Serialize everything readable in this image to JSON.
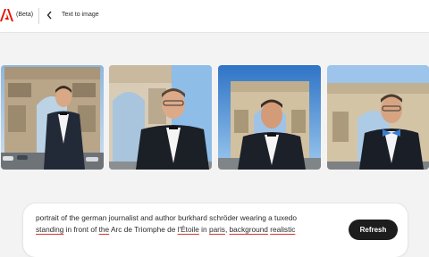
{
  "header": {
    "badge": "(Beta)",
    "title": "Text to image",
    "brand_color": "#eb1000"
  },
  "gallery": {
    "images": [
      {
        "label": "generated-image-1"
      },
      {
        "label": "generated-image-2"
      },
      {
        "label": "generated-image-3"
      },
      {
        "label": "generated-image-4"
      }
    ]
  },
  "prompt": {
    "segments": [
      "portrait of the german journalist and author burkhard schröder wearing a tuxedo",
      "standing",
      " in front of ",
      "the",
      " Arc de Triomphe de ",
      "l'Étoile",
      " in ",
      "paris",
      ", ",
      "background",
      " ",
      "realistic"
    ],
    "refresh_label": "Refresh"
  }
}
